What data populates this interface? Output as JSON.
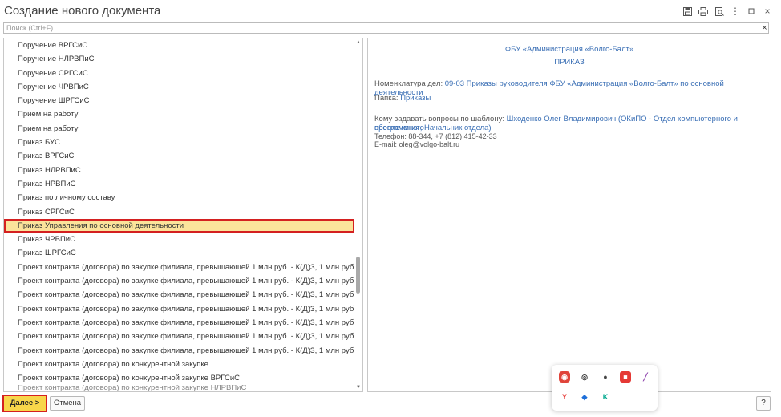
{
  "window": {
    "title": "Создание нового документа",
    "toolbar_icons": [
      "save-icon",
      "print-icon",
      "preview-icon",
      "more-icon",
      "minimize-icon",
      "maximize-icon",
      "close-icon"
    ]
  },
  "search": {
    "placeholder": "Поиск (Ctrl+F)",
    "clear_symbol": "×"
  },
  "templates": {
    "items": [
      "Поручение ВРГСиС",
      "Поручение НЛРВПиС",
      "Поручение СРГСиС",
      "Поручение ЧРВПиС",
      "Поручение ШРГСиС",
      "Прием на работу",
      "Прием на работу",
      "Приказ БУС",
      "Приказ ВРГСиС",
      "Приказ НЛРВПиС",
      "Приказ НРВПиС",
      "Приказ по личному составу",
      "Приказ СРГСиС",
      "Приказ Управления по основной деятельности",
      "Приказ ЧРВПиС",
      "Приказ ШРГСиС",
      "Проект контракта (договора) по закупке филиала, превышающей 1 млн руб. - К(Д)З, 1 млн руб БУС",
      "Проект контракта (договора) по закупке филиала, превышающей 1 млн руб. - К(Д)З, 1 млн руб ВРГСиС",
      "Проект контракта (договора) по закупке филиала, превышающей 1 млн руб. - К(Д)З, 1 млн руб НЛРВП...",
      "Проект контракта (договора) по закупке филиала, превышающей 1 млн руб. - К(Д)З, 1 млн руб НРВПиС",
      "Проект контракта (договора) по закупке филиала, превышающей 1 млн руб. - К(Д)З, 1 млн руб СРГСиС",
      "Проект контракта (договора) по закупке филиала, превышающей 1 млн руб. - К(Д)З, 1 млн руб ЧРВПиС",
      "Проект контракта (договора) по закупке филиала, превышающей 1 млн руб. - К(Д)З, 1 млн руб ШРГСиС",
      "Проект контракта (договора) по конкурентной закупке",
      "Проект контракта (договора) по конкурентной закупке ВРГСиС",
      "Проект контракта (договора) по конкурентной закупке НЛРВПиС"
    ],
    "selected_index": 13
  },
  "details": {
    "organization": "ФБУ «Администрация «Волго-Балт»",
    "document_type": "ПРИКАЗ",
    "nomenclature_label": "Номенклатура дел:",
    "nomenclature_value": "09-03 Приказы руководителя ФБУ «Администрация «Волго-Балт» по основной деятельности",
    "folder_label": "Папка:",
    "folder_value": "Приказы",
    "contact_label": "Кому задавать вопросы по шаблону:",
    "contact_value_line1": "Шходенко Олег Владимирович (ОКиПО - Отдел компьютерного и программного",
    "contact_value_line2": "обеспечения, Начальник отдела)",
    "phone": "Телефон: 88-344, +7 (812) 415-42-33",
    "email": "E-mail: oleg@volgo-balt.ru"
  },
  "footer": {
    "next_label": "Далее >",
    "cancel_label": "Отмена",
    "help_label": "?"
  },
  "tray_popup": {
    "icons": [
      "app-red-icon",
      "eye-icon",
      "obs-icon",
      "record-icon",
      "feather-icon",
      "yandex-icon",
      "shield-icon",
      "kaspersky-icon"
    ]
  }
}
